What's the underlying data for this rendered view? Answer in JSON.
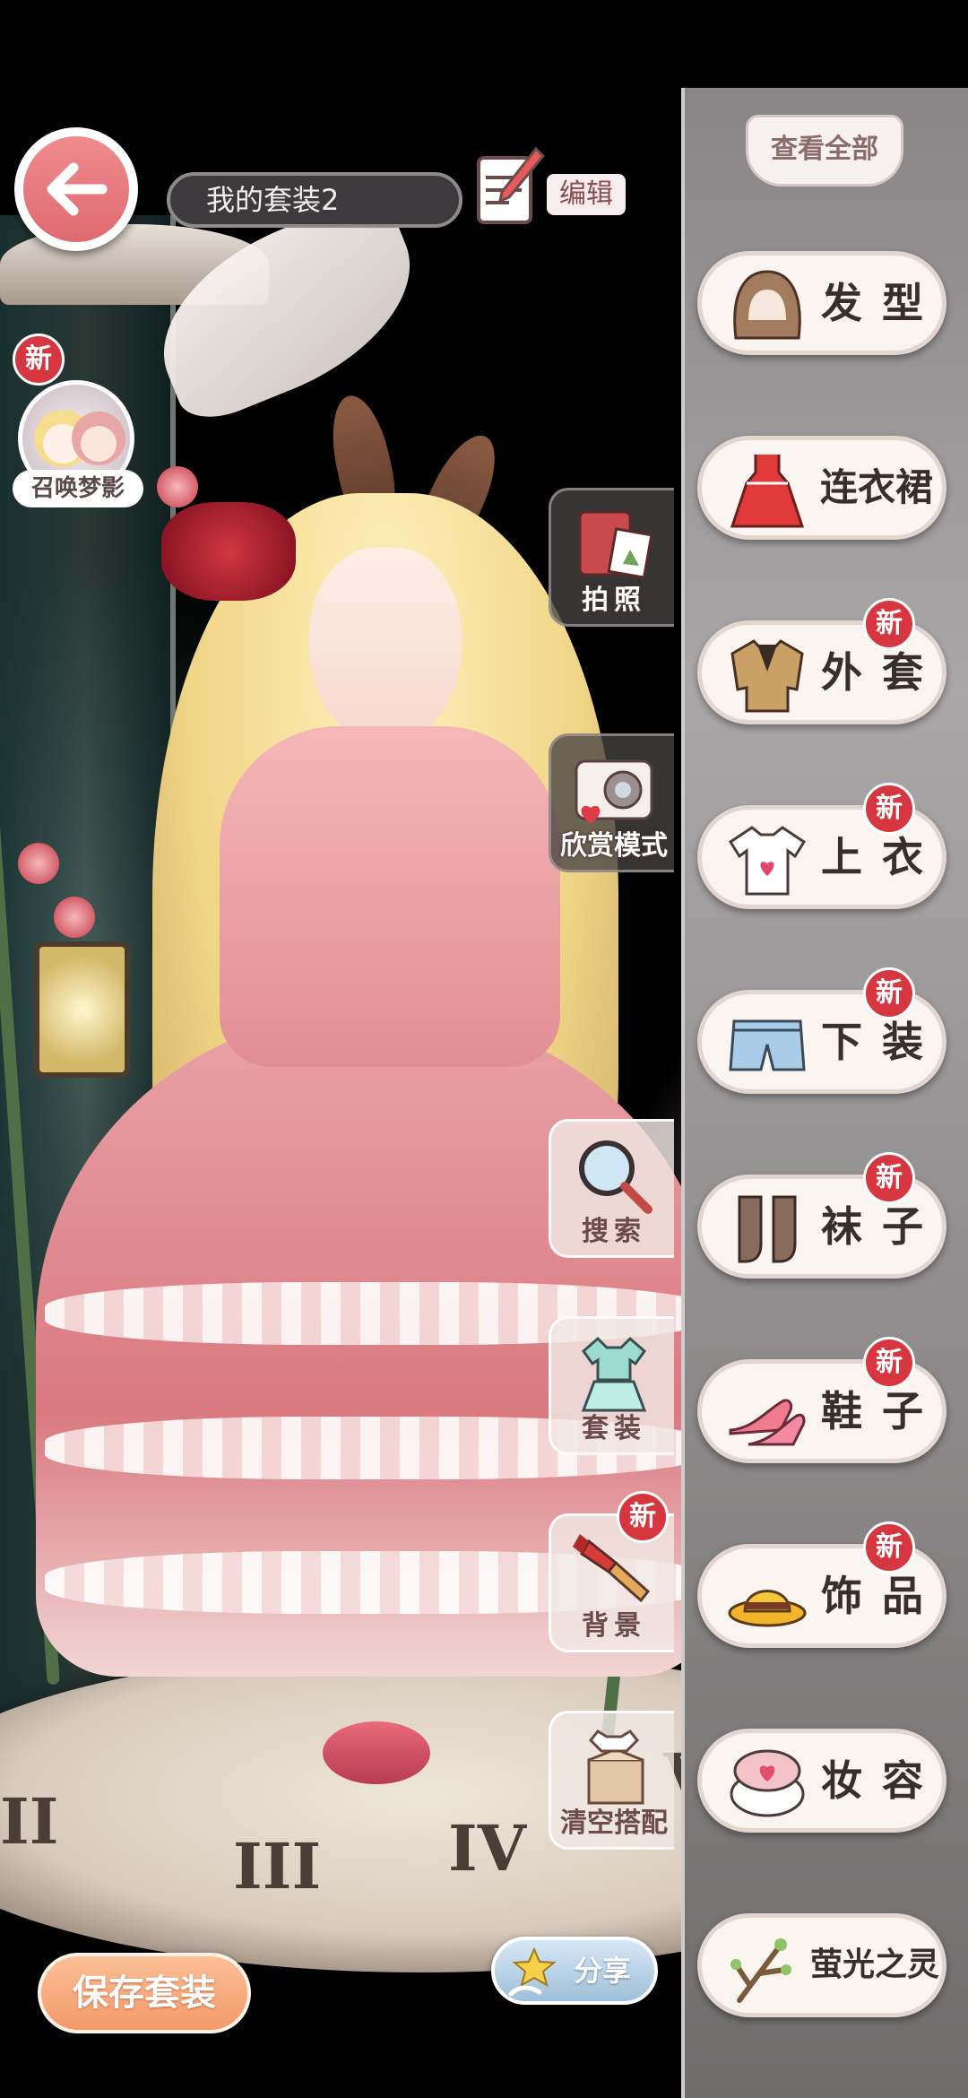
{
  "header": {
    "outfit_name": "我的套装2",
    "edit_label": "编辑"
  },
  "summon": {
    "badge": "新",
    "label": "召唤梦影"
  },
  "side_tools": [
    {
      "label": "拍照",
      "icon": "notebook-photo-icon"
    },
    {
      "label": "欣赏模式",
      "icon": "camera-icon"
    },
    {
      "label": "搜索",
      "icon": "magnifier-icon"
    },
    {
      "label": "套装",
      "icon": "outfit-set-icon"
    },
    {
      "label": "背景",
      "icon": "paint-brush-icon",
      "badge": "新"
    },
    {
      "label": "清空搭配",
      "icon": "clear-box-icon"
    }
  ],
  "panel": {
    "view_all": "查看全部",
    "categories": [
      {
        "label": "发型",
        "icon": "hairstyle-icon"
      },
      {
        "label": "连衣裙",
        "icon": "dress-icon"
      },
      {
        "label": "外套",
        "icon": "coat-icon",
        "badge": "新"
      },
      {
        "label": "上衣",
        "icon": "shirt-icon",
        "badge": "新"
      },
      {
        "label": "下装",
        "icon": "shorts-icon",
        "badge": "新"
      },
      {
        "label": "袜子",
        "icon": "socks-icon",
        "badge": "新"
      },
      {
        "label": "鞋子",
        "icon": "shoes-icon",
        "badge": "新"
      },
      {
        "label": "饰品",
        "icon": "hat-icon",
        "badge": "新"
      },
      {
        "label": "妆容",
        "icon": "makeup-compact-icon"
      },
      {
        "label": "萤光之灵",
        "icon": "branch-icon"
      }
    ]
  },
  "bottom": {
    "save_label": "保存套装",
    "share_label": "分享"
  },
  "colors": {
    "accent_pink": "#de6a70",
    "badge_red": "#d6363f",
    "save_orange": "#f39a6c",
    "panel_gray": "#8a8888"
  }
}
